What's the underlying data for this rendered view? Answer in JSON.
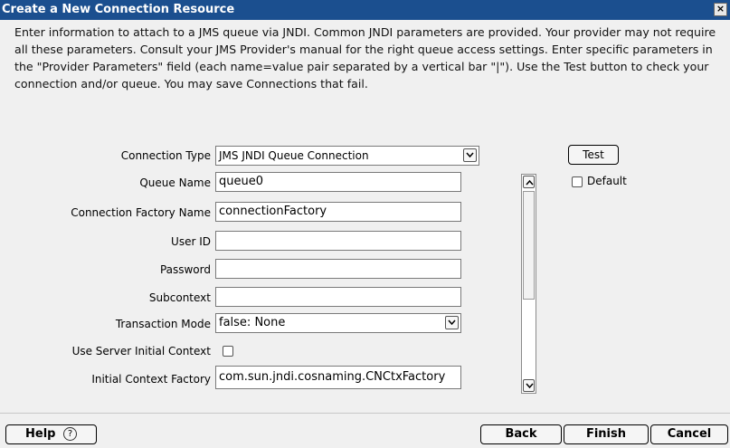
{
  "window": {
    "title": "Create a New Connection Resource",
    "close_glyph": "×"
  },
  "description": "Enter information to attach to a JMS queue via JNDI. Common JNDI parameters are provided. Your provider may not require all these parameters. Consult your JMS Provider's manual for the right queue access settings. Enter specific parameters in the \"Provider Parameters\" field (each name=value pair separated by a vertical bar \"|\"). Use the Test button to check your connection and/or queue. You may save Connections that fail.",
  "form": {
    "connection_type": {
      "label": "Connection Type",
      "value": "JMS JNDI Queue Connection"
    },
    "queue_name": {
      "label": "Queue Name",
      "value": "queue0"
    },
    "connection_factory_name": {
      "label": "Connection Factory Name",
      "value": "connectionFactory"
    },
    "user_id": {
      "label": "User ID",
      "value": ""
    },
    "password": {
      "label": "Password",
      "value": ""
    },
    "subcontext": {
      "label": "Subcontext",
      "value": ""
    },
    "transaction_mode": {
      "label": "Transaction Mode",
      "value": "false: None"
    },
    "use_server_initial_context": {
      "label": "Use Server Initial Context",
      "checked": false
    },
    "initial_context_factory": {
      "label": "Initial Context Factory",
      "value": "com.sun.jndi.cosnaming.CNCtxFactory"
    }
  },
  "side": {
    "test_label": "Test",
    "default_label": "Default",
    "default_checked": false
  },
  "footer": {
    "help_label": "Help",
    "help_icon": "?",
    "back_label": "Back",
    "finish_label": "Finish",
    "cancel_label": "Cancel"
  }
}
